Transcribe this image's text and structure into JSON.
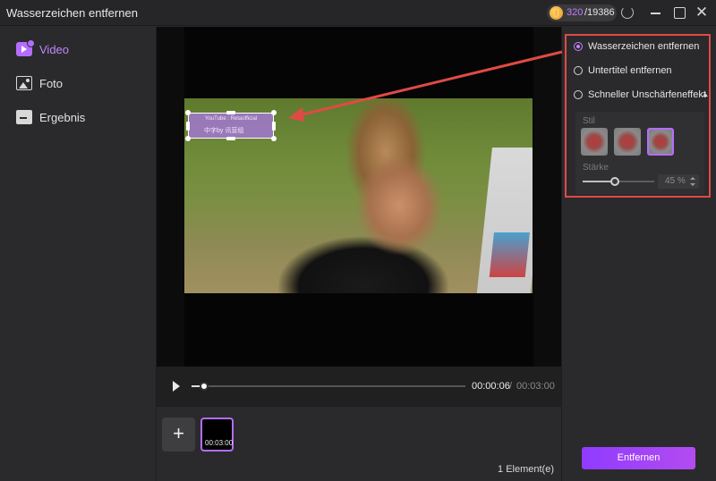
{
  "window": {
    "title": "Wasserzeichen entfernen",
    "credits_used": "320",
    "credits_total": "/19386"
  },
  "sidebar": {
    "items": [
      {
        "label": "Video",
        "icon": "video-icon",
        "active": true
      },
      {
        "label": "Foto",
        "icon": "photo-icon",
        "active": false
      },
      {
        "label": "Ergebnis",
        "icon": "folder-icon",
        "active": false
      }
    ]
  },
  "preview": {
    "watermark_line1": "YouTube : Retaofficial",
    "watermark_line2": "中字by 讯营组"
  },
  "playback": {
    "current_time": "00:00:06",
    "separator": "/",
    "total_time": "00:03:00",
    "progress": 0.033
  },
  "timeline": {
    "add_label": "+",
    "clip_duration": "00:03:00",
    "element_count": "1 Element(e)"
  },
  "options": {
    "items": [
      {
        "label": "Wasserzeichen entfernen",
        "checked": true
      },
      {
        "label": "Untertitel entfernen",
        "checked": false
      },
      {
        "label": "Schneller Unschärfeneffekt",
        "checked": false
      }
    ],
    "style_label": "Stil",
    "strength_label": "Stärke",
    "strength_value": "45 %",
    "strength": 0.45,
    "selected_style": 3
  },
  "actions": {
    "remove_label": "Entfernen"
  },
  "colors": {
    "accent": "#b46dff",
    "highlight_box": "#e04a45",
    "button_gradient_start": "#8f3bff",
    "button_gradient_end": "#b34cf0"
  }
}
